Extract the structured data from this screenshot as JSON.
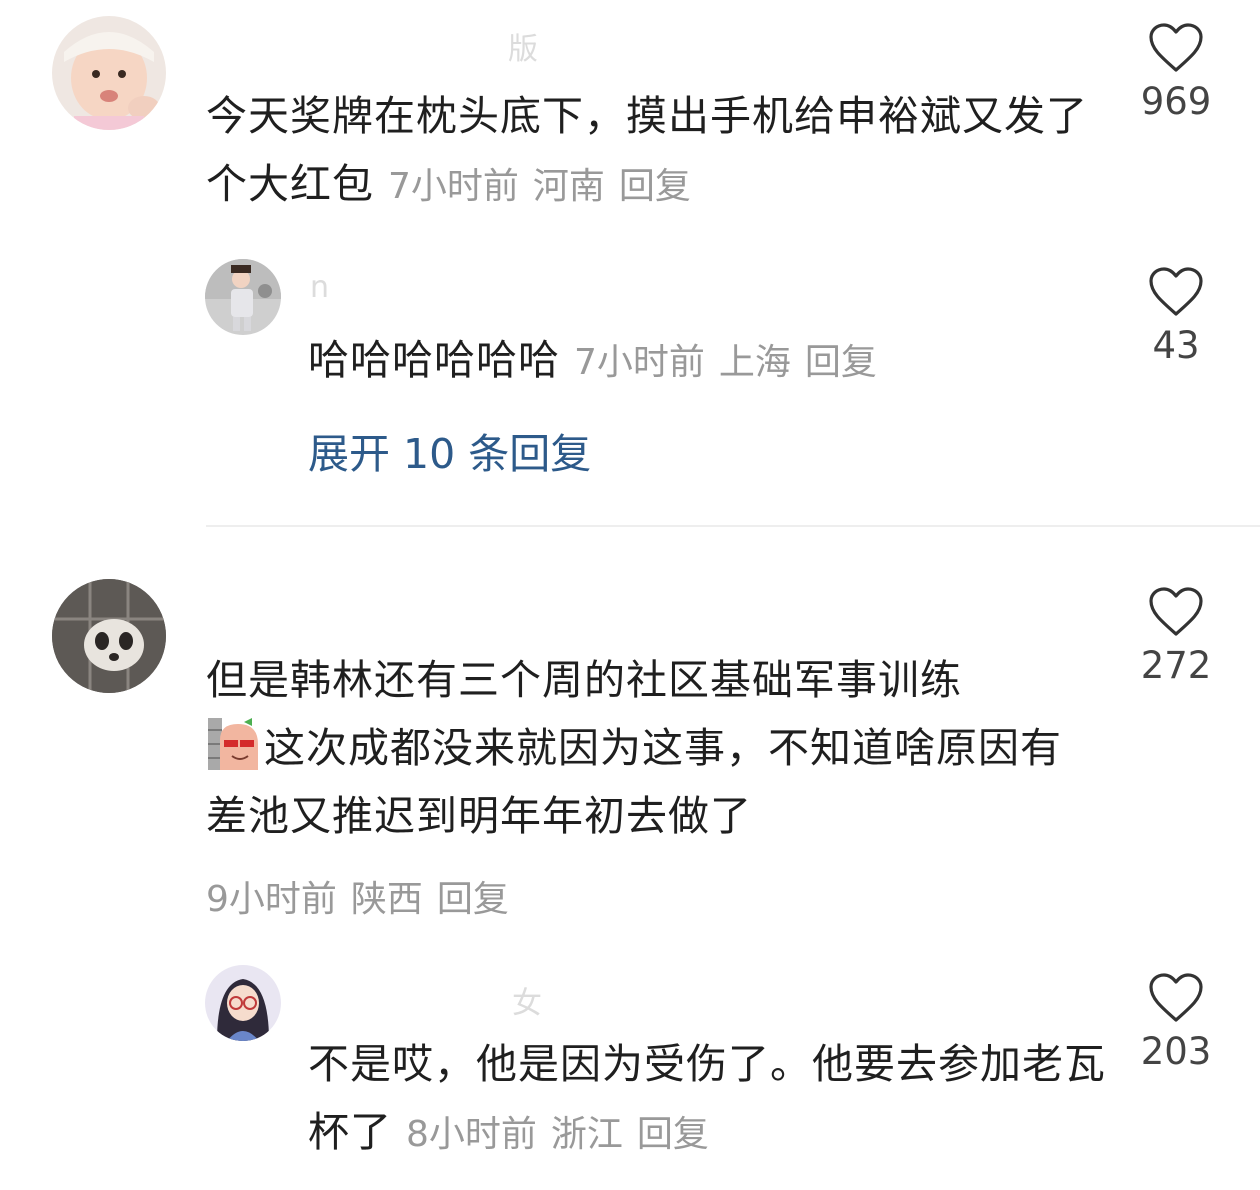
{
  "comments": [
    {
      "username": "版",
      "text": "今天奖牌在枕头底下，摸出手机给申裕斌又发了个大红包",
      "time": "7小时前",
      "location": "河南",
      "reply_label": "回复",
      "likes": "969",
      "replies": [
        {
          "username": "n",
          "text": "哈哈哈哈哈哈",
          "time": "7小时前",
          "location": "上海",
          "reply_label": "回复",
          "likes": "43"
        }
      ],
      "expand_label": "展开 10 条回复"
    },
    {
      "username": "",
      "text": "但是韩林还有三个周的社区基础军事训练",
      "text_after_emoji": "这次成都没来就因为这事，不知道啥原因有差池又推迟到明年年初去做了",
      "emoji": "sneaky-peek-emoji",
      "time": "9小时前",
      "location": "陕西",
      "reply_label": "回复",
      "likes": "272",
      "replies": [
        {
          "username": "女",
          "text": "不是哎，他是因为受伤了。他要去参加老瓦杯了",
          "time": "8小时前",
          "location": "浙江",
          "reply_label": "回复",
          "likes": "203"
        }
      ]
    }
  ],
  "colors": {
    "background": "#ffffff",
    "text": "#1f1f1f",
    "meta": "#999999",
    "link": "#2d5a8a",
    "divider": "#eeeeee"
  }
}
